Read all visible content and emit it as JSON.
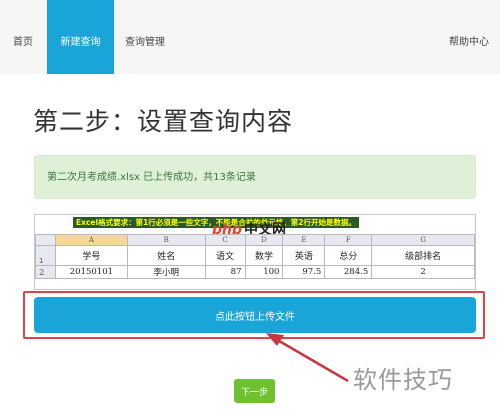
{
  "nav": {
    "home": "首页",
    "new_query": "新建查询",
    "query_manage": "查询管理",
    "help": "帮助中心"
  },
  "page_title": "第二步：设置查询内容",
  "alert": "第二次月考成绩.xlsx 已上传成功，共13条记录",
  "sheet": {
    "notice": "Excel格式要求：第1行必须是一些文字，不能是合并的单元格。第2行开始是数据。",
    "watermark_a": "php",
    "watermark_b": "中文网",
    "columns": [
      "A",
      "B",
      "C",
      "D",
      "E",
      "F",
      "G"
    ],
    "row_numbers": [
      "1",
      "2"
    ],
    "headers": [
      "学号",
      "姓名",
      "语文",
      "数学",
      "英语",
      "总分",
      "级部排名"
    ],
    "row": [
      "20150101",
      "李小明",
      "87",
      "100",
      "97.5",
      "284.5",
      "2"
    ]
  },
  "upload_button": "点此按钮上传文件",
  "next_button": "下一步",
  "brand_watermark": "软件技巧",
  "colors": {
    "accent": "#1aa5d9",
    "success": "#6ec12f",
    "highlight": "#e0444b"
  }
}
